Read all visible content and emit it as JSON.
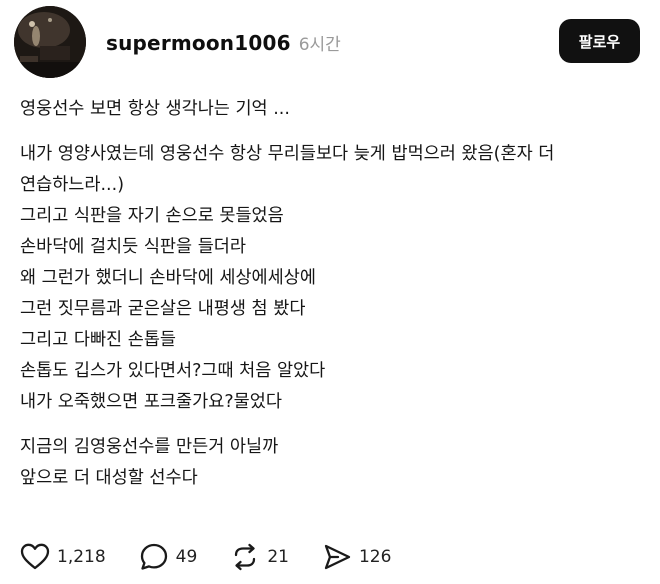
{
  "post": {
    "username": "supermoon1006",
    "time": "6시간",
    "follow_label": "팔로우",
    "paragraphs": [
      [
        "영웅선수 보면 항상 생각나는 기억 ..."
      ],
      [
        "내가 영양사였는데 영웅선수 항상 무리들보다 늦게 밥먹으러 왔음(혼자 더",
        "연습하느라...)",
        "그리고 식판을 자기 손으로 못들었음",
        "손바닥에 걸치듯 식판을 들더라",
        "왜 그런가 했더니 손바닥에 세상에세상에",
        "그런 짓무름과 굳은살은 내평생 첨 봤다",
        "그리고 다빠진 손톱들",
        "손톱도 깁스가 있다면서?그때 처음 알았다",
        "내가 오죽했으면 포크줄가요?물었다"
      ],
      [
        "지금의 김영웅선수를 만든거 아닐까",
        "앞으로 더 대성할 선수다"
      ]
    ],
    "actions": {
      "likes": "1,218",
      "comments": "49",
      "reposts": "21",
      "shares": "126"
    },
    "icons": {
      "like": "heart-icon",
      "comment": "comment-icon",
      "repost": "repost-icon",
      "share": "send-icon"
    },
    "colors": {
      "text": "#161616",
      "muted": "#9a9a9a",
      "button_bg": "#111111",
      "button_text": "#ffffff"
    }
  }
}
